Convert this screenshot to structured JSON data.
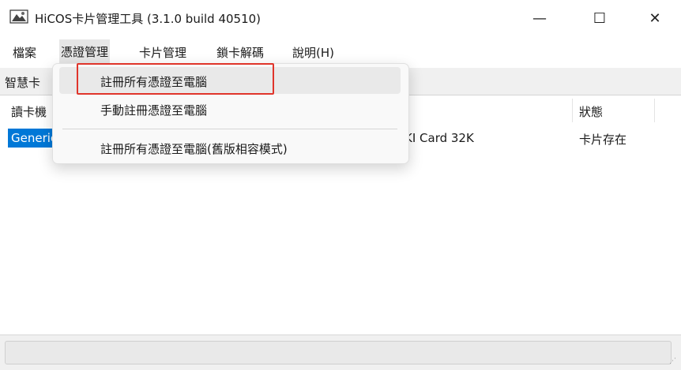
{
  "window": {
    "title": "HiCOS卡片管理工具 (3.1.0 build 40510)",
    "icon": "hicos-app-icon",
    "controls": {
      "minimize": "—",
      "maximize": "☐",
      "close": "✕"
    }
  },
  "menubar": {
    "items": [
      {
        "label": "檔案"
      },
      {
        "label": "憑證管理"
      },
      {
        "label": "卡片管理"
      },
      {
        "label": "鎖卡解碼"
      },
      {
        "label": "說明(H)"
      }
    ]
  },
  "tab": {
    "label": "智慧卡"
  },
  "list": {
    "headers": {
      "reader": "讀卡機",
      "status": "狀態"
    },
    "rows": [
      {
        "reader": "Generic",
        "card": "KI Card 32K",
        "status": "卡片存在"
      }
    ]
  },
  "dropdown": {
    "items": [
      {
        "label": "註冊所有憑證至電腦"
      },
      {
        "label": "手動註冊憑證至電腦"
      },
      {
        "label": "註冊所有憑證至電腦(舊版相容模式)"
      }
    ]
  },
  "colors": {
    "selection": "#0078d7",
    "annotation": "#e0352b"
  }
}
